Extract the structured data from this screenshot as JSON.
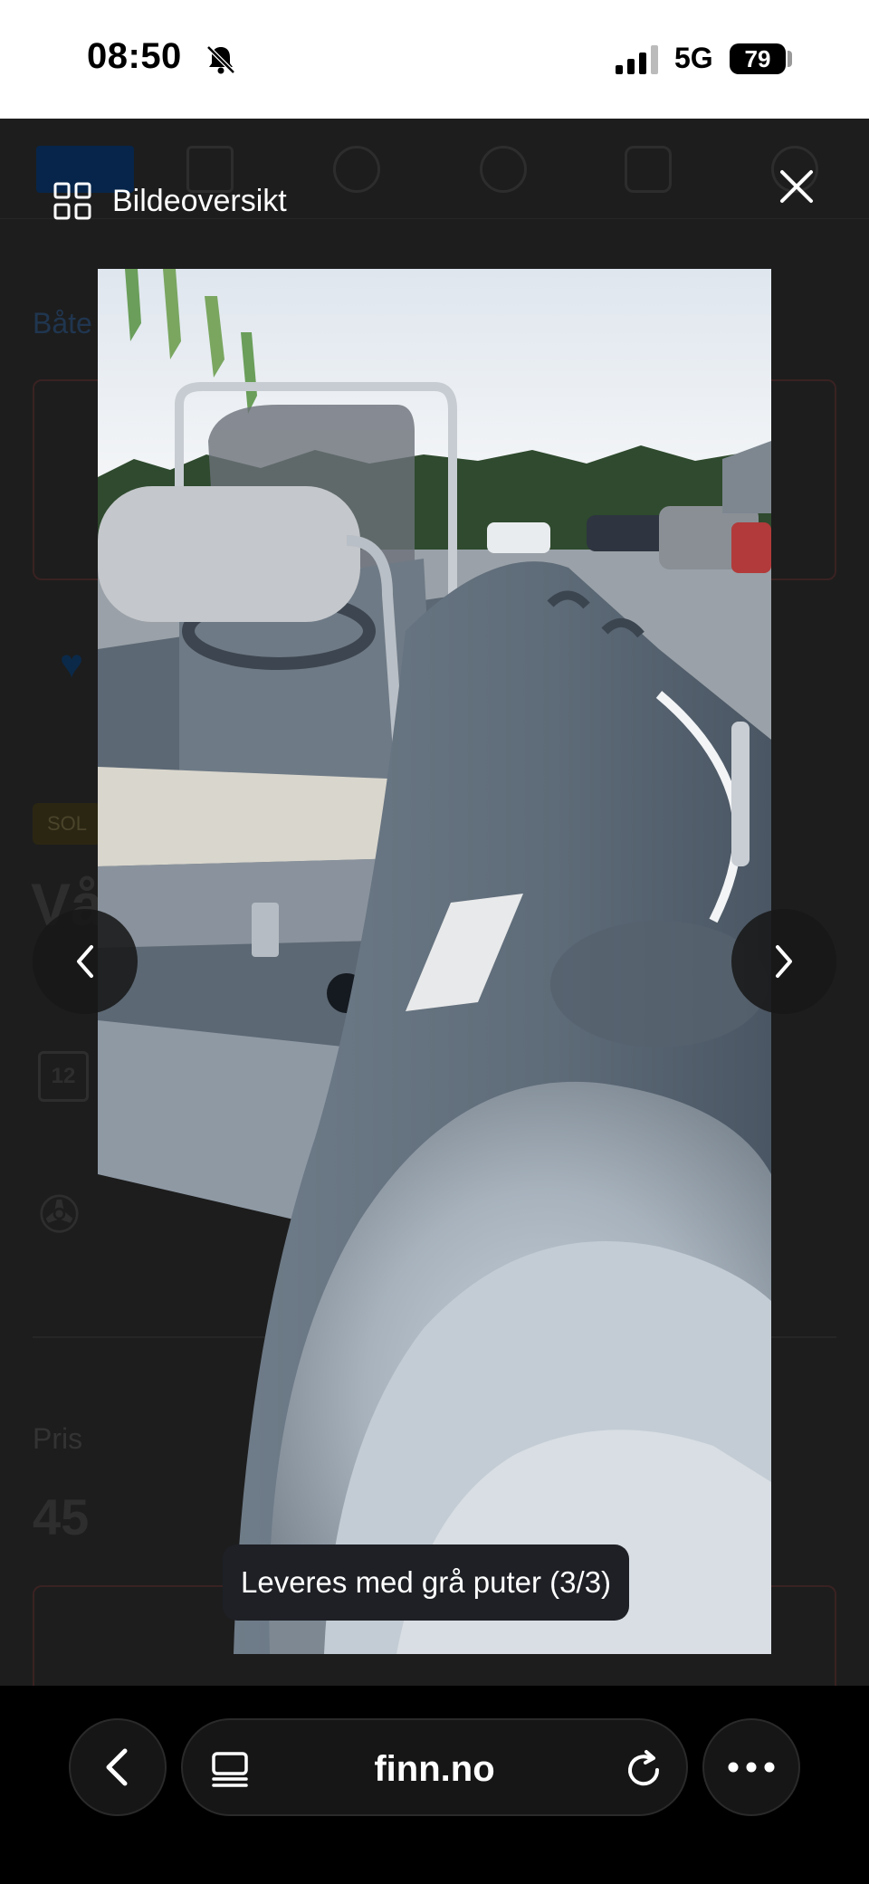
{
  "status_bar": {
    "time": "08:50",
    "network": "5G",
    "battery": "79",
    "icons": [
      "bell-slash-icon",
      "signal-icon"
    ]
  },
  "background_page": {
    "breadcrumb": "Båte",
    "badge": "SOL",
    "title": "Vå",
    "calendar_day": "12",
    "price_label": "Pris",
    "price": "45"
  },
  "overlay": {
    "gallery_label": "Bildeoversikt",
    "caption": "Leveres med grå puter (3/3)",
    "icons": [
      "grid-icon",
      "close-icon",
      "chevron-left-icon",
      "chevron-right-icon"
    ]
  },
  "browser": {
    "url": "finn.no",
    "icons": [
      "back-icon",
      "tabs-icon",
      "reload-icon",
      "more-icon"
    ]
  },
  "colors": {
    "overlay_bg": "#1b1b1b",
    "caption_bg": "#1e2026",
    "toolbar_bg": "#000000"
  }
}
